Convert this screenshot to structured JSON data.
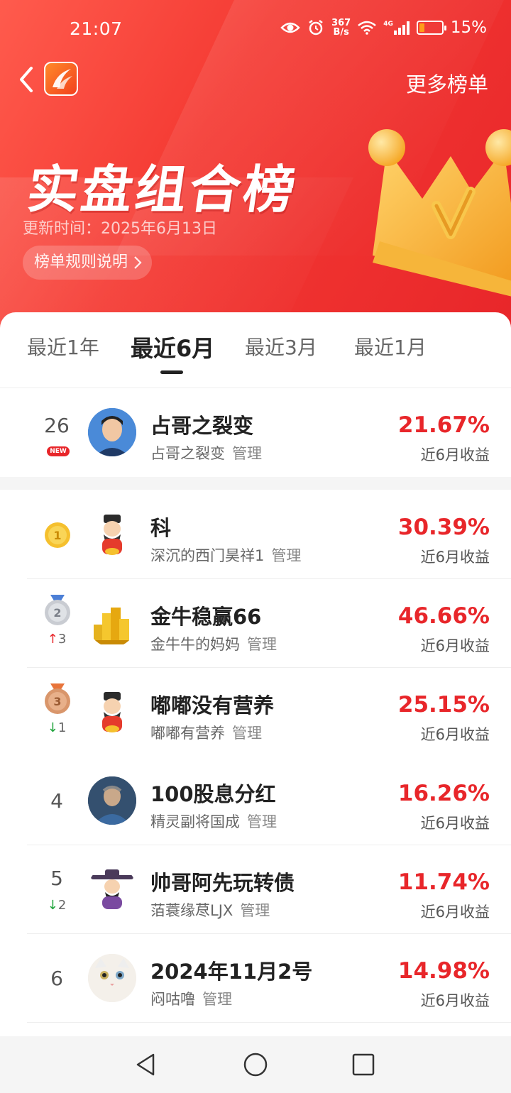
{
  "status_bar": {
    "time": "21:07",
    "net_speed_value": "367",
    "net_speed_unit": "B/s",
    "network_type": "4G",
    "battery_percent": "15%",
    "battery_level": 0.15
  },
  "header": {
    "more_lists_label": "更多榜单",
    "hero_title": "实盘组合榜",
    "update_time": "更新时间：2025年6月13日",
    "rules_button_label": "榜单规则说明"
  },
  "tabs": [
    {
      "label": "最近1年",
      "active": false
    },
    {
      "label": "最近6月",
      "active": true
    },
    {
      "label": "最近3月",
      "active": false
    },
    {
      "label": "最近1月",
      "active": false
    }
  ],
  "my_entry": {
    "rank": "26",
    "badge": "NEW",
    "name": "占哥之裂变",
    "owner": "占哥之裂变",
    "manage_label": "管理",
    "return_pct": "21.67%",
    "return_label": "近6月收益"
  },
  "rankings": [
    {
      "rank": "1",
      "medal": "gold",
      "change": "",
      "change_dir": "",
      "name": "科",
      "owner": "深沉的西门昊祥1",
      "manage_label": "管理",
      "return_pct": "30.39%",
      "return_label": "近6月收益",
      "avatar": "fortune-god-avatar"
    },
    {
      "rank": "2",
      "medal": "silver",
      "change": "3",
      "change_dir": "up",
      "name": "金牛稳赢66",
      "owner": "金牛牛的妈妈",
      "manage_label": "管理",
      "return_pct": "46.66%",
      "return_label": "近6月收益",
      "avatar": "gold-bars-avatar"
    },
    {
      "rank": "3",
      "medal": "bronze",
      "change": "1",
      "change_dir": "down",
      "name": "嘟嘟没有营养",
      "owner": "嘟嘟有营养",
      "manage_label": "管理",
      "return_pct": "25.15%",
      "return_label": "近6月收益",
      "avatar": "fortune-god-avatar"
    },
    {
      "rank": "4",
      "medal": "",
      "change": "",
      "change_dir": "",
      "name": "100股息分红",
      "owner": "精灵副将国成",
      "manage_label": "管理",
      "return_pct": "16.26%",
      "return_label": "近6月收益",
      "avatar": "man-photo-avatar"
    },
    {
      "rank": "5",
      "medal": "",
      "change": "2",
      "change_dir": "down",
      "name": "帅哥阿先玩转债",
      "owner": "萡蓑缘荩LJX",
      "manage_label": "管理",
      "return_pct": "11.74%",
      "return_label": "近6月收益",
      "avatar": "official-avatar"
    },
    {
      "rank": "6",
      "medal": "",
      "change": "",
      "change_dir": "",
      "name": "2024年11月2号",
      "owner": "闷咕噜",
      "manage_label": "管理",
      "return_pct": "14.98%",
      "return_label": "近6月收益",
      "avatar": "white-cat-avatar"
    }
  ],
  "colors": {
    "accent_red": "#e8262a",
    "up_red": "#e8262a",
    "down_green": "#1fa33b",
    "gold": "#f5c02e",
    "silver": "#c9ccd2",
    "bronze": "#d9966b"
  }
}
